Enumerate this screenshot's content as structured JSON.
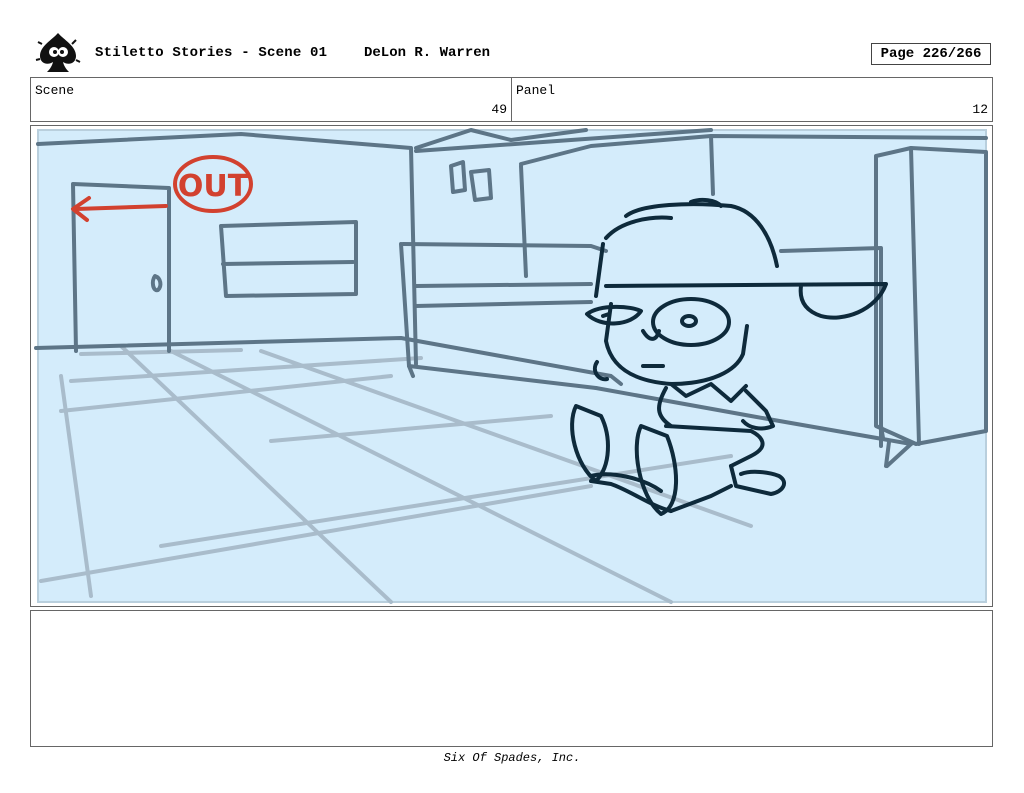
{
  "header": {
    "title": "Stiletto Stories - Scene 01",
    "author": "DeLon R. Warren",
    "page": "Page 226/266"
  },
  "info": {
    "scene_label": "Scene",
    "scene_value": "49",
    "panel_label": "Panel",
    "panel_value": "12"
  },
  "artwork": {
    "sign_text": "OUT",
    "sky_color": "#d4ecfb",
    "line_color": "#5d7587",
    "ink_color": "#0e2a3b",
    "accent_color": "#d2412f"
  },
  "notes": {
    "text": ""
  },
  "footer": {
    "company": "Six Of Spades, Inc."
  }
}
